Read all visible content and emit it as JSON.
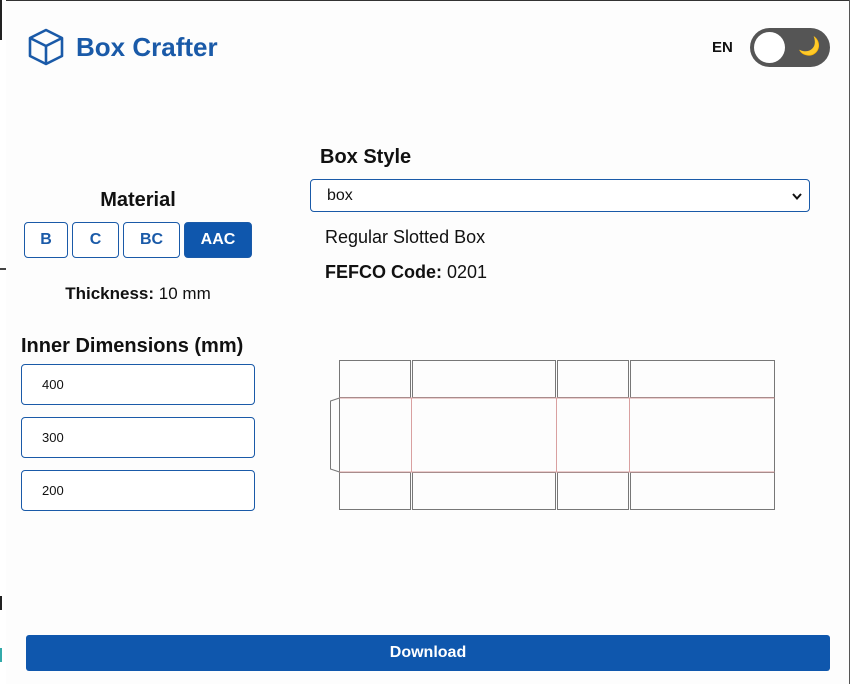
{
  "header": {
    "title": "Box Crafter",
    "language": "EN",
    "logo_icon": "cube-icon",
    "theme_icon": "moon-icon"
  },
  "material": {
    "title": "Material",
    "options": [
      "B",
      "C",
      "BC",
      "AAC"
    ],
    "selected": "AAC",
    "thickness_label": "Thickness:",
    "thickness_value": "10 mm"
  },
  "dimensions": {
    "title": "Inner Dimensions (mm)",
    "length": "400",
    "width": "300",
    "height": "200"
  },
  "box_style": {
    "title": "Box Style",
    "selected": "box",
    "name": "Regular Slotted Box",
    "fefco_label": "FEFCO Code:",
    "fefco_value": "0201"
  },
  "actions": {
    "download_label": "Download"
  },
  "colors": {
    "accent": "#0f57ad",
    "title": "#1a5aa8",
    "cut_line": "#777777",
    "fold_line": "#d9a0a0"
  }
}
